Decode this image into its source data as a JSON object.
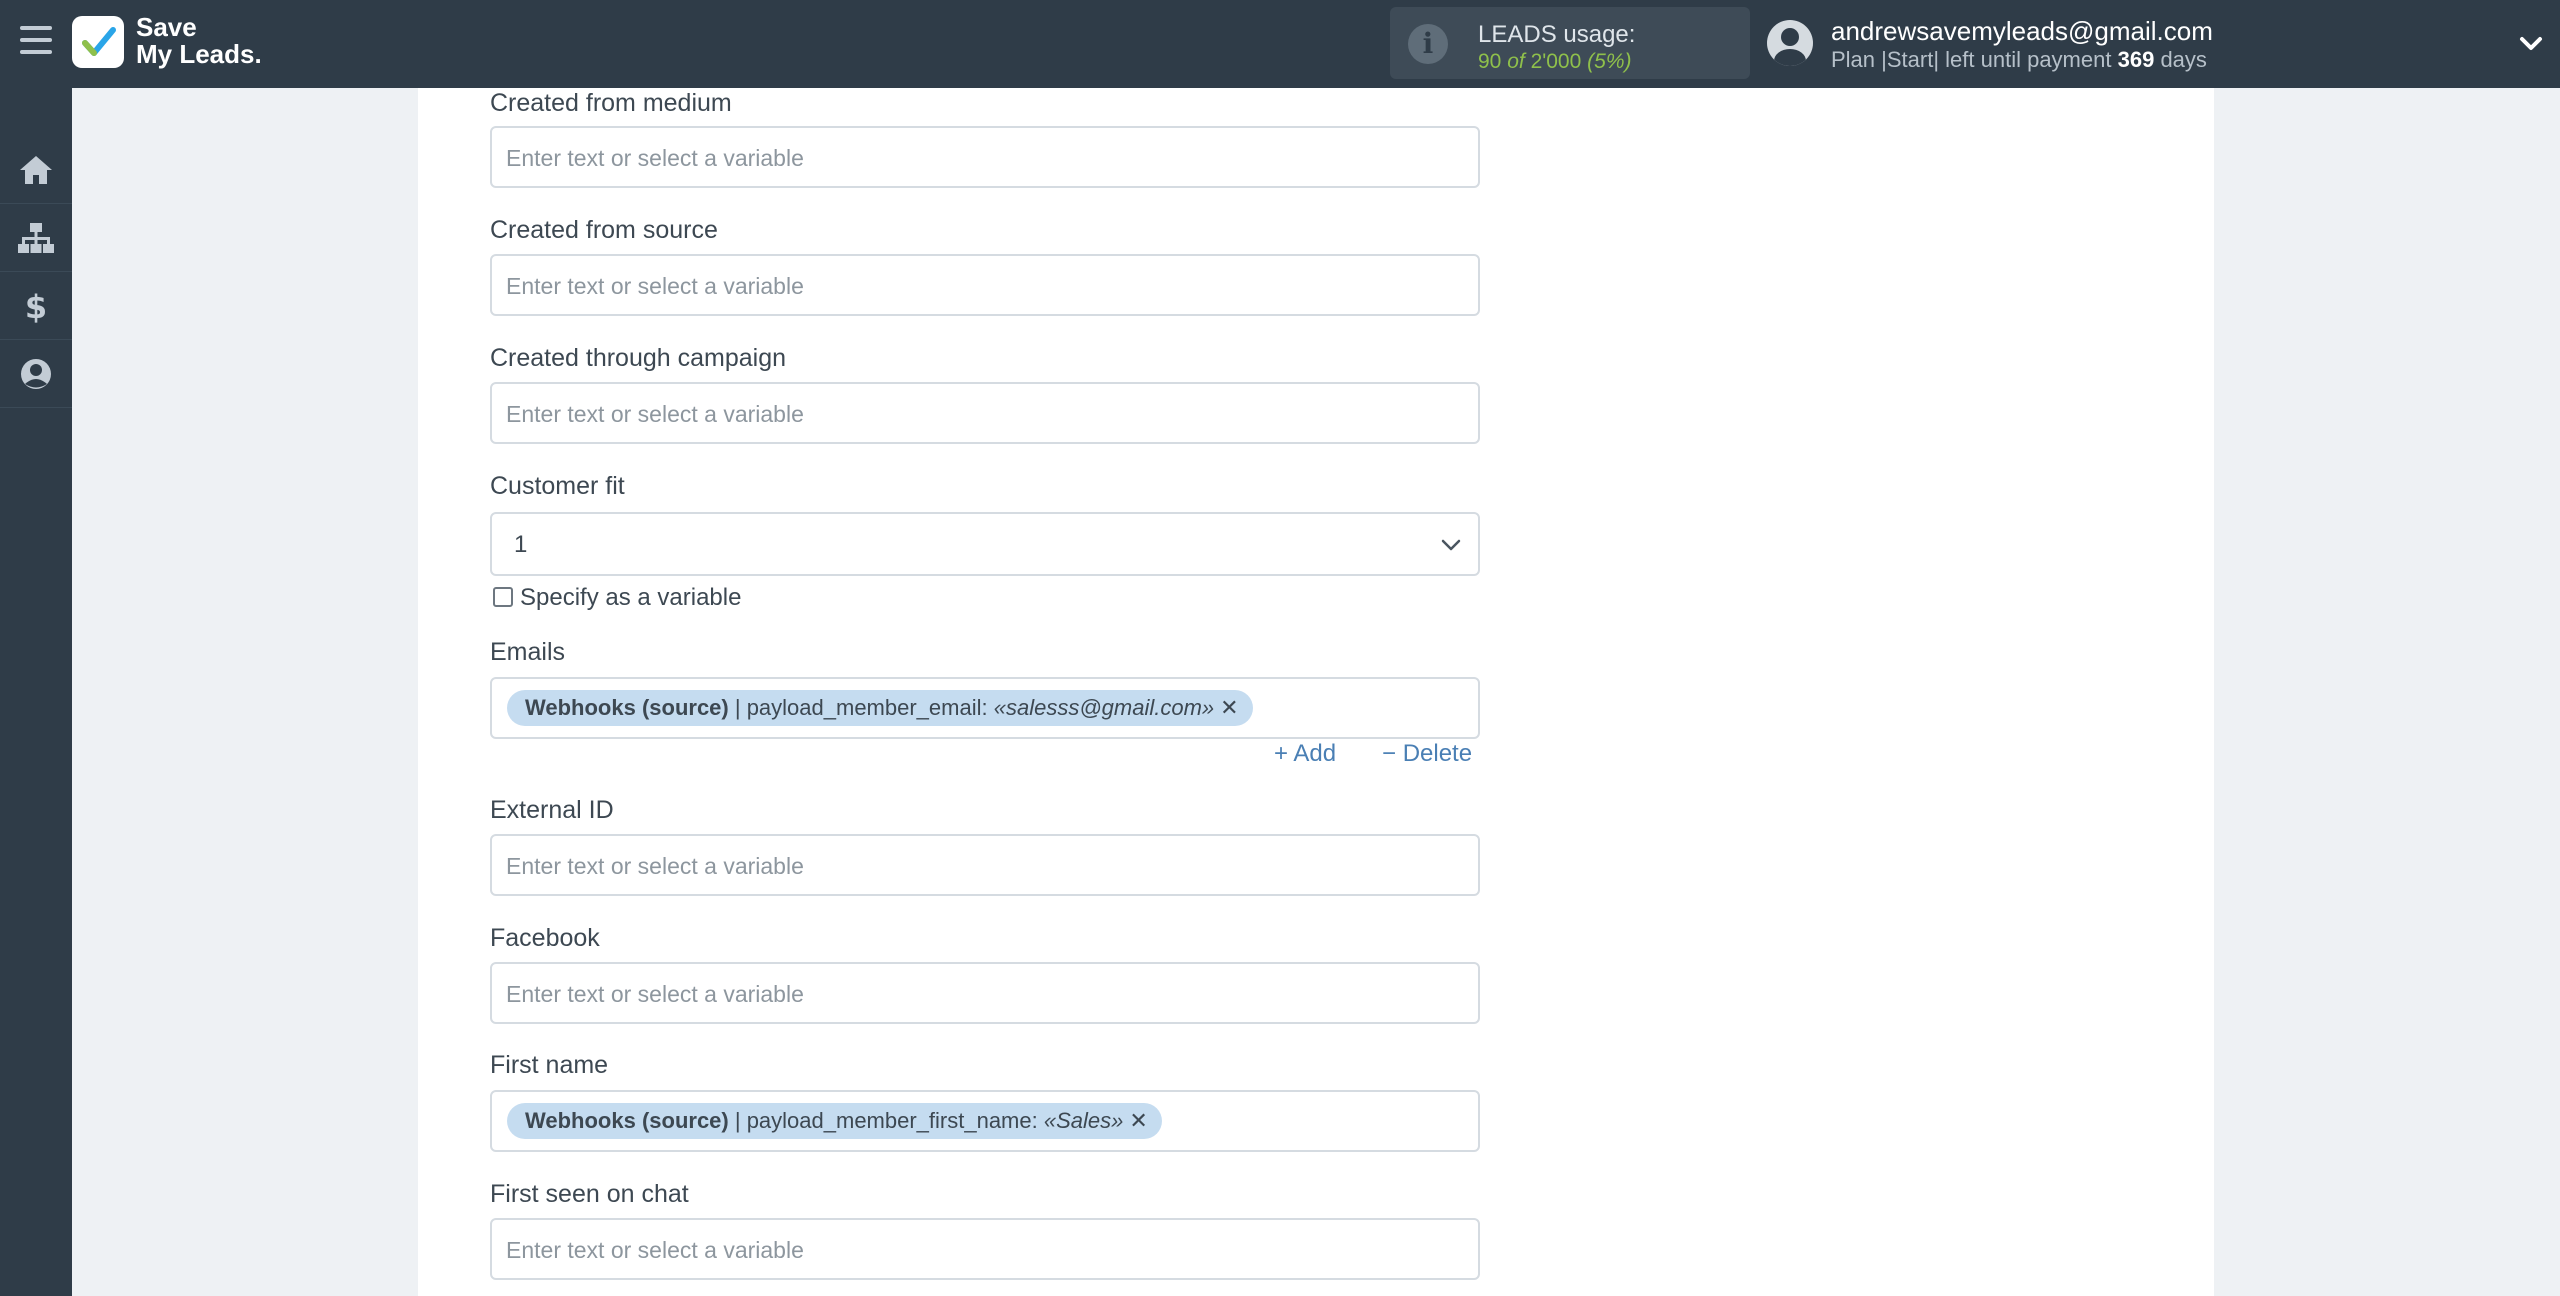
{
  "header": {
    "logo_text_line1": "Save",
    "logo_text_line2": "My Leads.",
    "usage_label": "LEADS usage:",
    "usage_used": "90",
    "usage_of": "of",
    "usage_total": "2'000",
    "usage_percent": "(5%)",
    "user_email": "andrewsavemyleads@gmail.com",
    "plan_prefix": "Plan |Start| left until payment",
    "plan_days": "369",
    "plan_suffix": "days"
  },
  "sidebar": {
    "items": [
      {
        "name": "home-icon"
      },
      {
        "name": "sitemap-icon"
      },
      {
        "name": "dollar-icon"
      },
      {
        "name": "user-circle-icon"
      }
    ]
  },
  "form": {
    "placeholder": "Enter text or select a variable",
    "fields": {
      "created_from_medium": {
        "label": "Created from medium"
      },
      "created_from_source": {
        "label": "Created from source"
      },
      "created_through_campaign": {
        "label": "Created through campaign"
      },
      "customer_fit": {
        "label": "Customer fit",
        "value": "1",
        "checkbox_label": "Specify as a variable"
      },
      "emails": {
        "label": "Emails",
        "tag_source": "Webhooks (source)",
        "tag_field": " | payload_member_email: ",
        "tag_value": "«salesss@gmail.com»",
        "add_label": "Add",
        "delete_label": "Delete"
      },
      "external_id": {
        "label": "External ID"
      },
      "facebook": {
        "label": "Facebook"
      },
      "first_name": {
        "label": "First name",
        "tag_source": "Webhooks (source)",
        "tag_field": " | payload_member_first_name: ",
        "tag_value": "«Sales»"
      },
      "first_seen_on_chat": {
        "label": "First seen on chat"
      }
    }
  },
  "colors": {
    "topbar": "#2f3c48",
    "tag_bg": "#c5dcf0",
    "link": "#4a7fb4",
    "usage_green": "#8fc04b"
  }
}
